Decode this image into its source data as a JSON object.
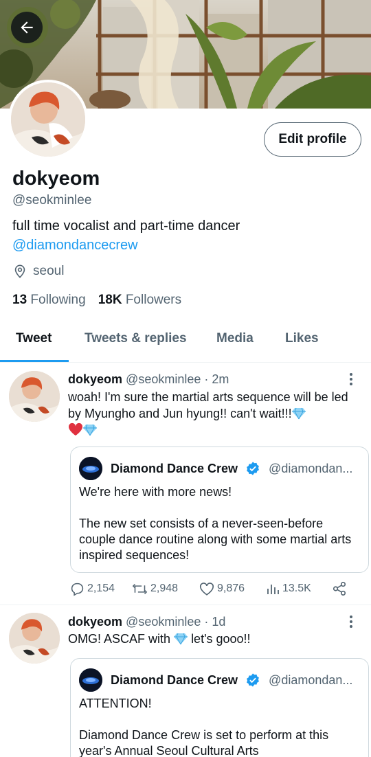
{
  "profile": {
    "display_name": "dokyeom",
    "handle": "@seokminlee",
    "bio_text": "full time vocalist and part-time dancer",
    "bio_link": "@diamondancecrew",
    "location": "seoul",
    "following_count": "13",
    "following_label": "Following",
    "followers_count": "18K",
    "followers_label": "Followers",
    "edit_label": "Edit profile"
  },
  "tabs": [
    {
      "label": "Tweet",
      "active": true
    },
    {
      "label": "Tweets & replies",
      "active": false
    },
    {
      "label": "Media",
      "active": false
    },
    {
      "label": "Likes",
      "active": false
    }
  ],
  "tweets": [
    {
      "name": "dokyeom",
      "meta": "@seokminlee · 2m",
      "text_line1": "woah! I'm sure the martial arts sequence will be",
      "text_line2": "led by Myungho and Jun hyung!! can't wait!!!",
      "quote": {
        "name": "Diamond Dance Crew",
        "handle": "@diamondan...",
        "para1": "We're here with more news!",
        "para2": "The new set consists of a never-seen-before couple dance routine along with some martial arts inspired sequences!"
      },
      "actions": {
        "replies": "2,154",
        "retweets": "2,948",
        "likes": "9,876",
        "views": "13.5K"
      }
    },
    {
      "name": "dokyeom",
      "meta": "@seokminlee · 1d",
      "text_before": "OMG! ASCAF with",
      "text_after": "let's gooo!!",
      "quote": {
        "name": "Diamond Dance Crew",
        "handle": "@diamondan...",
        "para1": "ATTENTION!",
        "para2": "Diamond Dance Crew is set to perform at this year's Annual Seoul Cultural Arts"
      }
    }
  ],
  "icons": {
    "back": "arrow-left-icon",
    "location": "location-pin-icon",
    "more": "more-vertical-icon",
    "reply": "reply-icon",
    "retweet": "retweet-icon",
    "like": "heart-icon",
    "views": "views-icon",
    "share": "share-icon",
    "gem": "gem-emoji-icon",
    "heart_emoji": "red-heart-emoji-icon",
    "verified": "verified-badge-icon"
  },
  "colors": {
    "accent": "#1d9bf0",
    "text_primary": "#0f1419",
    "text_secondary": "#536471",
    "border": "#cfd9de"
  }
}
